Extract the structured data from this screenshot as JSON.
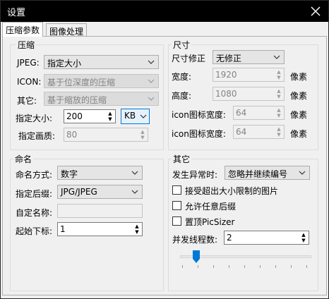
{
  "window": {
    "title": "设置"
  },
  "tabs": [
    {
      "label": "压缩参数"
    },
    {
      "label": "图像处理"
    }
  ],
  "compression": {
    "title": "压缩",
    "jpeg": {
      "label": "JPEG:",
      "value": "指定大小"
    },
    "icon": {
      "label": "ICON:",
      "value": "基于位深度的压缩"
    },
    "other": {
      "label": "其它:",
      "value": "基于缩放的压缩"
    },
    "size": {
      "label": "指定大小:",
      "value": "200",
      "unit": "KB"
    },
    "quality": {
      "label": "指定画质:",
      "value": "80"
    }
  },
  "dimensions": {
    "title": "尺寸",
    "correction": {
      "label": "尺寸修正",
      "value": "无修正"
    },
    "width": {
      "label": "宽度:",
      "value": "1920",
      "unit": "像素"
    },
    "height": {
      "label": "高度:",
      "value": "1080",
      "unit": "像素"
    },
    "icon_width": {
      "label": "icon图标宽度:",
      "value": "64",
      "unit": "像素"
    },
    "icon_height": {
      "label": "icon图标宽度:",
      "value": "64",
      "unit": "像素"
    }
  },
  "naming": {
    "title": "命名",
    "mode": {
      "label": "命名方式:",
      "value": "数字"
    },
    "suffix": {
      "label": "指定后缀:",
      "value": "JPG/JPEG"
    },
    "custom_name": {
      "label": "自定名称:",
      "value": ""
    },
    "start_index": {
      "label": "起始下标:",
      "value": "1"
    }
  },
  "other": {
    "title": "其它",
    "on_error": {
      "label": "发生异常时:",
      "value": "忽略并继续编号"
    },
    "accept_oversize": {
      "label": "接受超出大小限制的图片",
      "checked": false
    },
    "allow_any_suffix": {
      "label": "允许任意后缀",
      "checked": false
    },
    "pin_picsizer": {
      "label": "置顶PicSizer",
      "checked": false
    },
    "threads": {
      "label": "并发线程数:",
      "value": "2"
    },
    "thread_slider": {
      "level": 0.1
    }
  },
  "colors": {
    "accent": "#0078d7",
    "titlebar": "#000000"
  }
}
